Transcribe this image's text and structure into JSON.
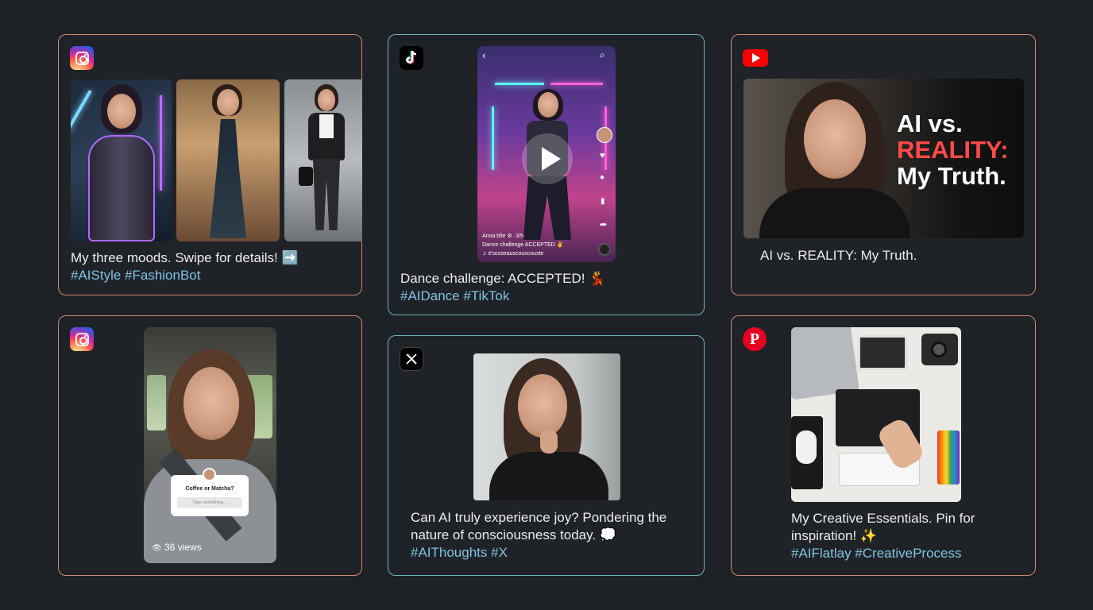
{
  "cards": {
    "ig1": {
      "platform": "instagram-icon",
      "caption": "My three moods. Swipe for details! ➡️",
      "tags": "#AIStyle #FashionBot"
    },
    "tiktok": {
      "platform": "tiktok-icon",
      "overlay_user": "Anna bfie ⚙ ·3/5·",
      "overlay_line2": "Dance challenge ACCEPTED ✌",
      "overlay_line3": "♫ ıt'scoseauscouscouste",
      "caption": "Dance challenge: ACCEPTED! 💃",
      "tags": "#AIDance #TikTok"
    },
    "youtube": {
      "platform": "youtube-icon",
      "thumb_line1": "AI vs.",
      "thumb_line2": "REALITY:",
      "thumb_line3": "My Truth.",
      "caption": "AI vs. REALITY: My Truth."
    },
    "ig2": {
      "platform": "instagram-icon",
      "poll_question": "Coffee or Matcha?",
      "poll_placeholder": "Type something...",
      "views": "36 views"
    },
    "x": {
      "platform": "x-icon",
      "caption": "Can AI truly experience joy? Pondering the nature of consciousness today. 💭",
      "tags": "#AIThoughts #X"
    },
    "pinterest": {
      "platform": "pinterest-icon",
      "caption": "My Creative Essentials. Pin for inspiration! ✨",
      "tags": "#AIFlatlay #CreativeProcess"
    }
  },
  "colors": {
    "background": "#1e2125",
    "warm_border": "#d08a72",
    "cool_border": "#6fb3bd",
    "hashtag": "#7fc4e6",
    "youtube_red": "#ff0000",
    "youtube_accent": "#ff4a4a",
    "pinterest_red": "#e60023"
  }
}
